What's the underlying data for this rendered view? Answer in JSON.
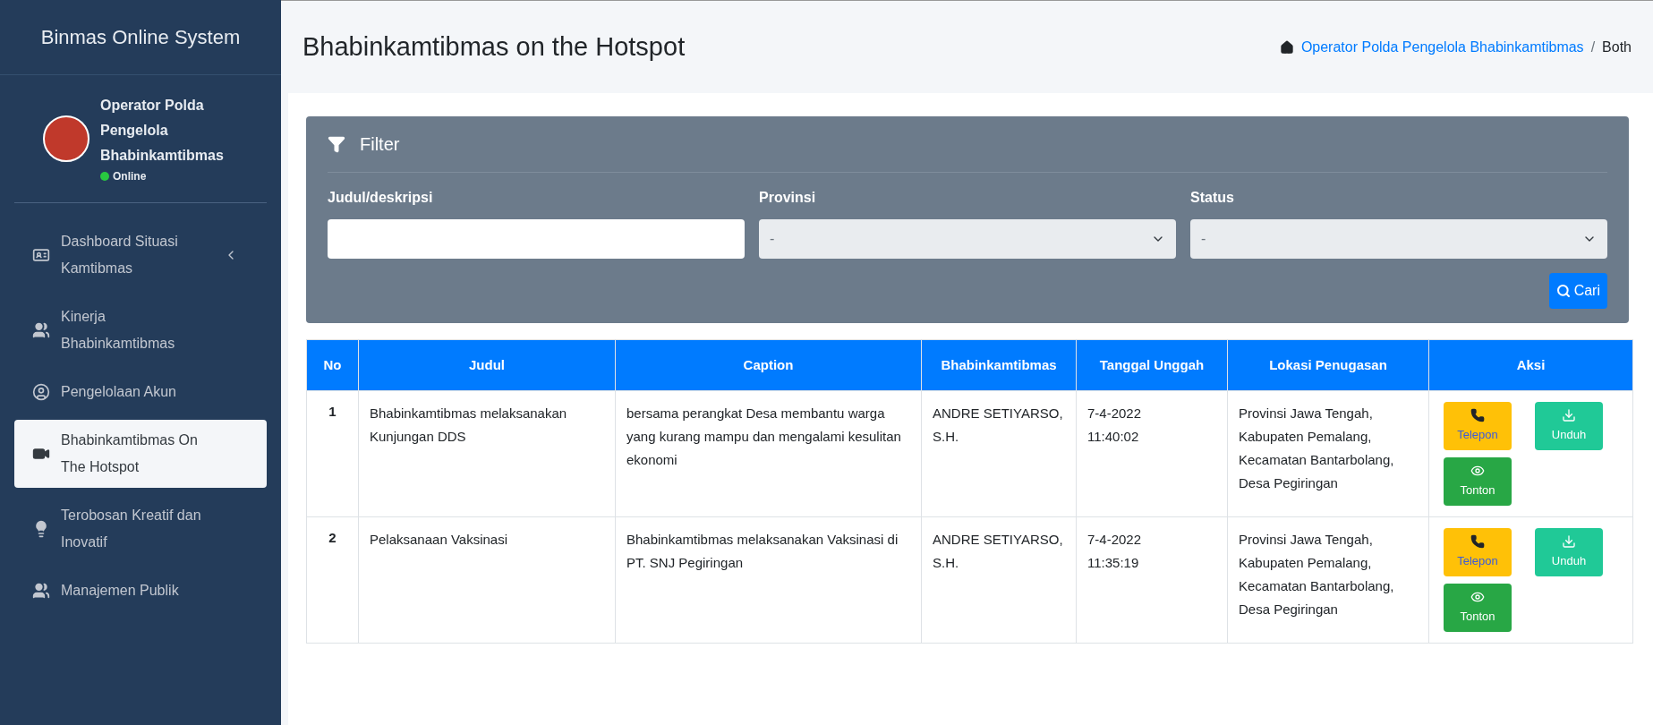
{
  "sidebar": {
    "brand": "Binmas Online System",
    "user": {
      "name": "Operator Polda Pengelola Bhabinkamtibmas",
      "status": "Online"
    },
    "items": [
      {
        "kind": "idcard",
        "label": "Dashboard Situasi Kamtibmas",
        "has_submenu": true,
        "selected": false
      },
      {
        "kind": "users",
        "label": "Kinerja Bhabinkamtibmas",
        "has_submenu": false,
        "selected": false
      },
      {
        "kind": "user",
        "label": "Pengelolaan Akun",
        "has_submenu": false,
        "selected": false
      },
      {
        "kind": "video",
        "label": "Bhabinkamtibmas On The Hotspot",
        "has_submenu": false,
        "selected": true
      },
      {
        "kind": "bulb",
        "label": "Terobosan Kreatif dan Inovatif",
        "has_submenu": false,
        "selected": false
      },
      {
        "kind": "users",
        "label": "Manajemen Publik",
        "has_submenu": false,
        "selected": false
      }
    ]
  },
  "page": {
    "title": "Bhabinkamtibmas on the Hotspot",
    "breadcrumb": [
      "Operator Polda Pengelola Bhabinkamtibmas",
      "/",
      "Both"
    ]
  },
  "filter": {
    "title": "Filter",
    "fields": [
      {
        "kind": "text",
        "label": "Judul/deskripsi"
      },
      {
        "kind": "select",
        "label": "Provinsi",
        "value": "-"
      },
      {
        "kind": "select",
        "label": "Status",
        "value": "-"
      }
    ],
    "button": "Cari"
  },
  "table": {
    "columns": [
      "No",
      "Judul",
      "Caption",
      "Bhabinkamtibmas",
      "Tanggal Unggah",
      "Lokasi Penugasan",
      "Aksi"
    ],
    "rows": [
      {
        "no": "1",
        "judul": "Bhabinkamtibmas melaksanakan Kunjungan DDS",
        "caption": "bersama perangkat Desa membantu warga yang kurang mampu dan mengalami kesulitan ekonomi",
        "bhabinkamtibmas": "ANDRE SETIYARSO, S.H.",
        "tanggal": [
          "7-4-2022",
          "11:40:02"
        ],
        "lokasi": "Provinsi Jawa Tengah, Kabupaten Pemalang, Kecamatan Bantarbolang, Desa Pegiringan",
        "actions": [
          {
            "kind": "phone",
            "label": "Telepon"
          },
          {
            "kind": "download",
            "label": "Unduh"
          },
          {
            "kind": "watch",
            "label": "Tonton"
          }
        ]
      },
      {
        "no": "2",
        "judul": "Pelaksanaan Vaksinasi",
        "caption": "Bhabinkamtibmas melaksanakan Vaksinasi di PT. SNJ Pegiringan",
        "bhabinkamtibmas": "ANDRE SETIYARSO, S.H.",
        "tanggal": [
          "7-4-2022",
          "11:35:19"
        ],
        "lokasi": "Provinsi Jawa Tengah, Kabupaten Pemalang, Kecamatan Bantarbolang, Desa Pegiringan",
        "actions": [
          {
            "kind": "phone",
            "label": "Telepon"
          },
          {
            "kind": "download",
            "label": "Unduh"
          },
          {
            "kind": "watch",
            "label": "Tonton"
          }
        ]
      }
    ]
  }
}
